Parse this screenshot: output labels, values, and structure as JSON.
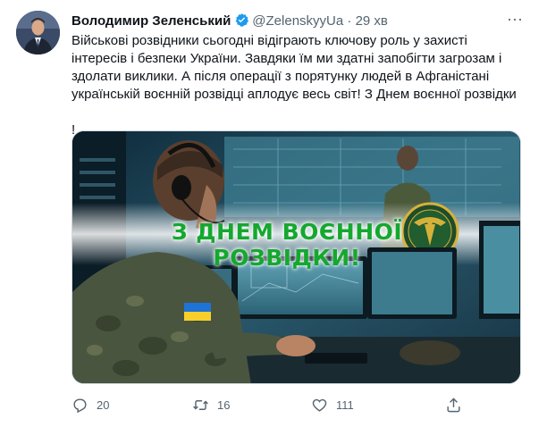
{
  "tweet": {
    "author_name": "Володимир Зеленський",
    "handle": "@ZelenskyyUa",
    "separator": "·",
    "time": "29 хв",
    "more_label": "···",
    "text_lines": [
      "Військові розвідники сьогодні відіграють ключову роль у захисті",
      "інтересів і безпеки України. Завдяки їм ми здатні запобігти загрозам і",
      "здолати виклики. А після операції з порятунку людей в Афганістані",
      "українській воєнній розвідці аплодує весь світ! З Днем воєнної розвідки"
    ],
    "text_last_suffix": "!",
    "media": {
      "banner_text": "З ДНЕМ ВОЄННОЇ РОЗВІДКИ!"
    },
    "actions": {
      "replies": "20",
      "retweets": "16",
      "likes": "111"
    }
  },
  "colors": {
    "accent": "#1d9bf0",
    "banner_green": "#15a82f",
    "muted": "#536471"
  }
}
